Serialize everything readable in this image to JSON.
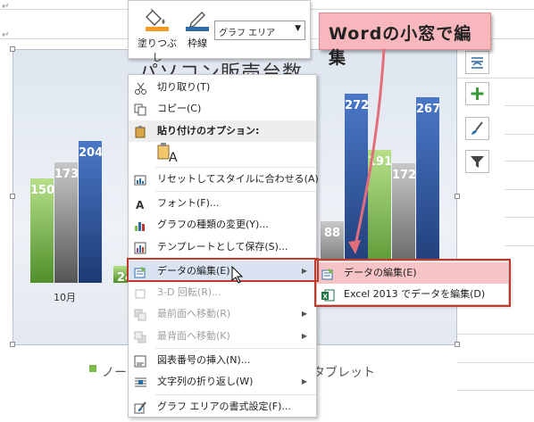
{
  "toolbar": {
    "fill_label": "塗りつぶし",
    "outline_label": "枠線",
    "element_select": "グラフ エリア"
  },
  "callout": {
    "text": "Wordの小窓で編集"
  },
  "chart": {
    "title": "パソコン販売台数",
    "legend_left": "ノー",
    "legend_right": "タブレット"
  },
  "chart_data": {
    "type": "bar",
    "title": "パソコン販売台数",
    "categories": [
      "10月",
      "",
      "",
      ""
    ],
    "series": [
      {
        "name": "ノー",
        "values": [
          150,
          24,
          null,
          191
        ]
      },
      {
        "name": "",
        "values": [
          173,
          null,
          88,
          172
        ]
      },
      {
        "name": "タブレット",
        "values": [
          204,
          null,
          272,
          267
        ]
      }
    ],
    "colors": [
      "#7cba4a",
      "#8c8c8c",
      "#2f5597"
    ]
  },
  "menu": {
    "items": [
      {
        "label": "切り取り(T)",
        "icon": "scissors-icon",
        "enabled": true
      },
      {
        "label": "コピー(C)",
        "icon": "copy-icon",
        "enabled": true
      },
      {
        "label": "貼り付けのオプション:",
        "icon": "paste-icon",
        "header": true
      },
      {
        "label": "",
        "icon": "paste-format-icon",
        "enabled": true
      },
      {
        "label": "リセットしてスタイルに合わせる(A)",
        "icon": "reset-style-icon",
        "enabled": true
      },
      {
        "label": "フォント(F)...",
        "icon": "font-icon",
        "enabled": true
      },
      {
        "label": "グラフの種類の変更(Y)...",
        "icon": "chart-type-icon",
        "enabled": true
      },
      {
        "label": "テンプレートとして保存(S)...",
        "icon": "template-icon",
        "enabled": true
      },
      {
        "label": "データの編集(E)",
        "icon": "edit-data-icon",
        "enabled": true,
        "submenu": true
      },
      {
        "label": "3-D 回転(R)...",
        "icon": "rotate-3d-icon",
        "enabled": false
      },
      {
        "label": "最前面へ移動(R)",
        "icon": "bring-front-icon",
        "enabled": false,
        "submenu": true
      },
      {
        "label": "最背面へ移動(K)",
        "icon": "send-back-icon",
        "enabled": false,
        "submenu": true
      },
      {
        "label": "図表番号の挿入(N)...",
        "icon": "caption-icon",
        "enabled": true
      },
      {
        "label": "文字列の折り返し(W)",
        "icon": "wrap-text-icon",
        "enabled": true,
        "submenu": true
      },
      {
        "label": "グラフ エリアの書式設定(F)...",
        "icon": "format-area-icon",
        "enabled": true
      }
    ],
    "paste_letter": "A"
  },
  "submenu": {
    "items": [
      {
        "label": "データの編集(E)",
        "icon": "edit-data-icon"
      },
      {
        "label": "Excel 2013 でデータを編集(D)",
        "icon": "excel-icon"
      }
    ]
  }
}
